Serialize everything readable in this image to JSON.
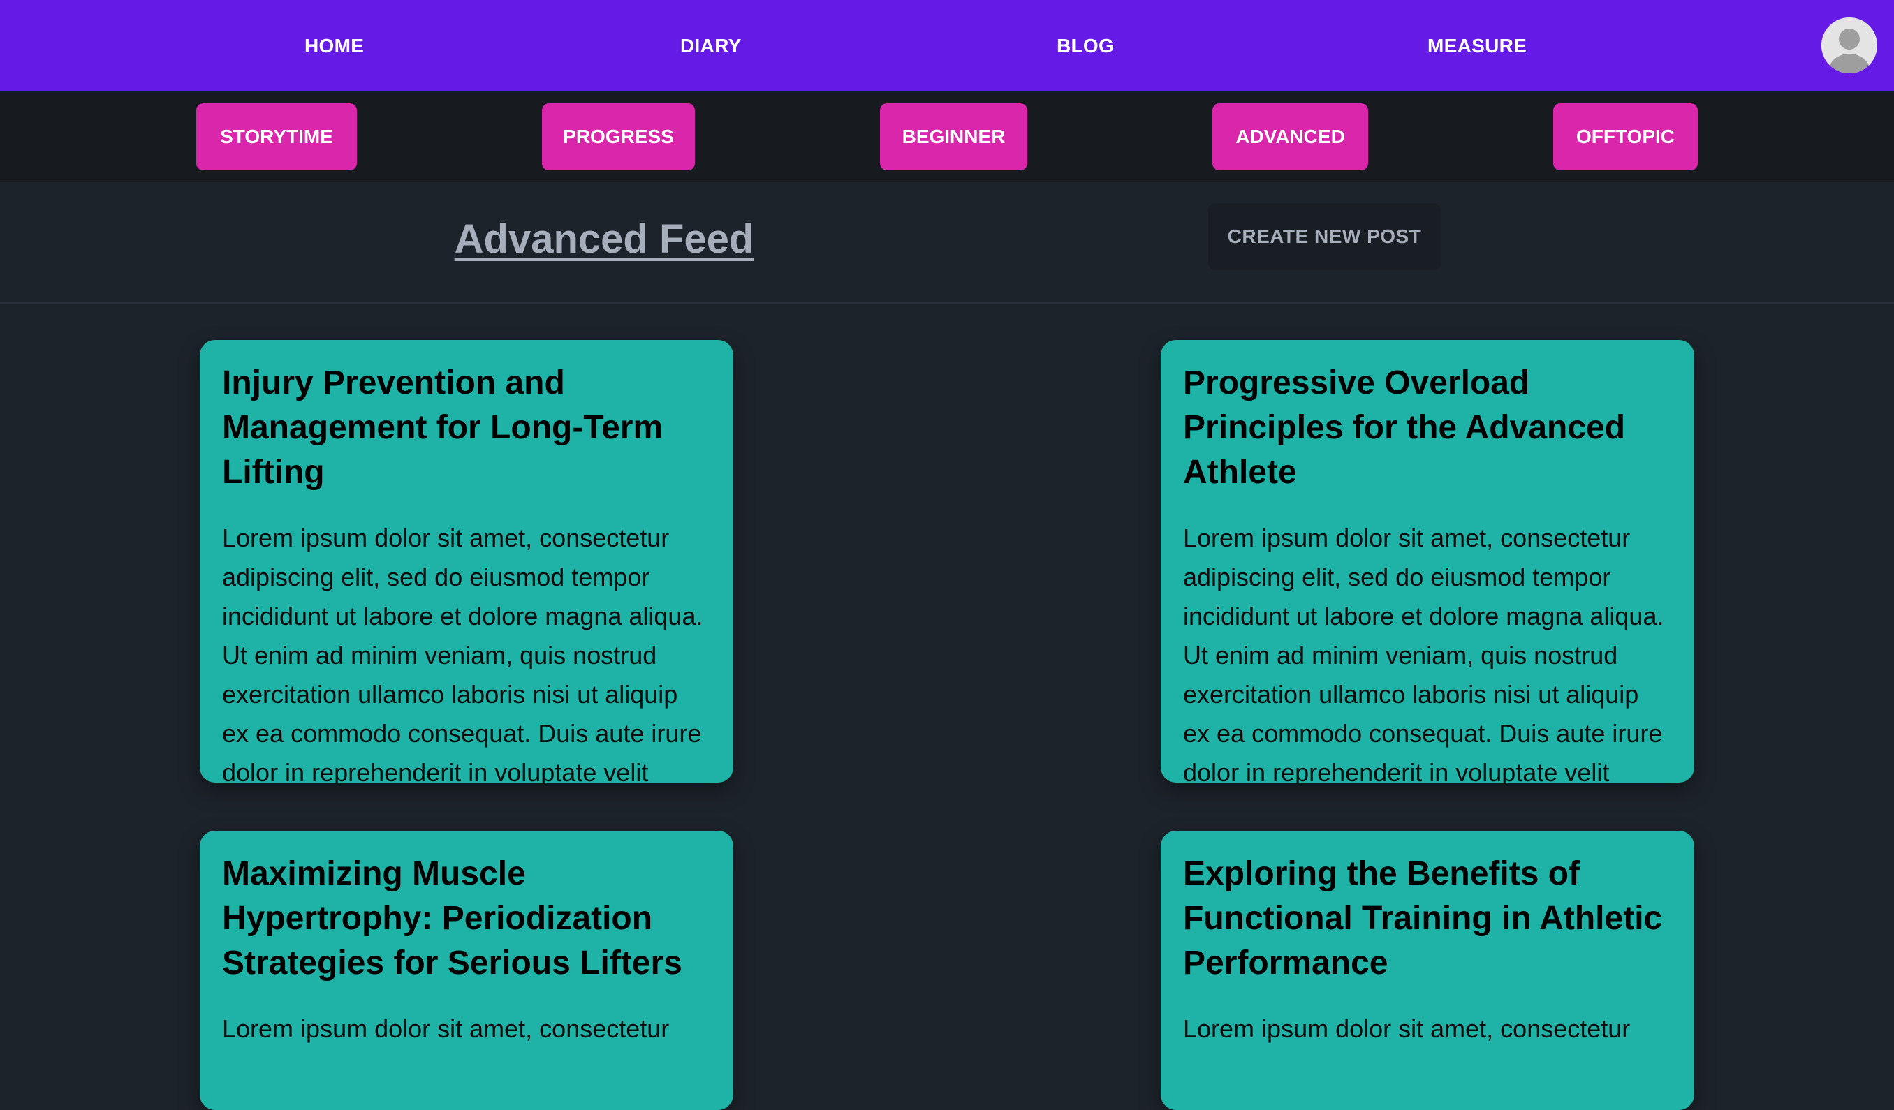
{
  "nav": {
    "home": "HOME",
    "diary": "DIARY",
    "blog": "BLOG",
    "measure": "MEASURE"
  },
  "categories": [
    "STORYTIME",
    "PROGRESS",
    "BEGINNER",
    "ADVANCED",
    "OFFTOPIC"
  ],
  "feed": {
    "title": "Advanced Feed",
    "create_button": "CREATE NEW POST"
  },
  "posts": [
    {
      "title": "Injury Prevention and Management for Long-Term Lifting",
      "body": "Lorem ipsum dolor sit amet, consectetur adipiscing elit, sed do eiusmod tempor incididunt ut labore et dolore magna aliqua. Ut enim ad minim veniam, quis nostrud exercitation ullamco laboris nisi ut aliquip ex ea commodo consequat. Duis aute irure dolor in reprehenderit in voluptate velit"
    },
    {
      "title": "Progressive Overload Principles for the Advanced Athlete",
      "body": "Lorem ipsum dolor sit amet, consectetur adipiscing elit, sed do eiusmod tempor incididunt ut labore et dolore magna aliqua. Ut enim ad minim veniam, quis nostrud exercitation ullamco laboris nisi ut aliquip ex ea commodo consequat. Duis aute irure dolor in reprehenderit in voluptate velit"
    },
    {
      "title": "Maximizing Muscle Hypertrophy: Periodization Strategies for Serious Lifters",
      "body": "Lorem ipsum dolor sit amet, consectetur"
    },
    {
      "title": "Exploring the Benefits of Functional Training in Athletic Performance",
      "body": "Lorem ipsum dolor sit amet, consectetur"
    }
  ],
  "colors": {
    "nav_bg": "#661ae6",
    "category_button": "#d926aa",
    "card_bg": "#1fb2a6",
    "page_bg": "#1d232a"
  },
  "icons": {
    "avatar": "user-avatar-icon"
  }
}
